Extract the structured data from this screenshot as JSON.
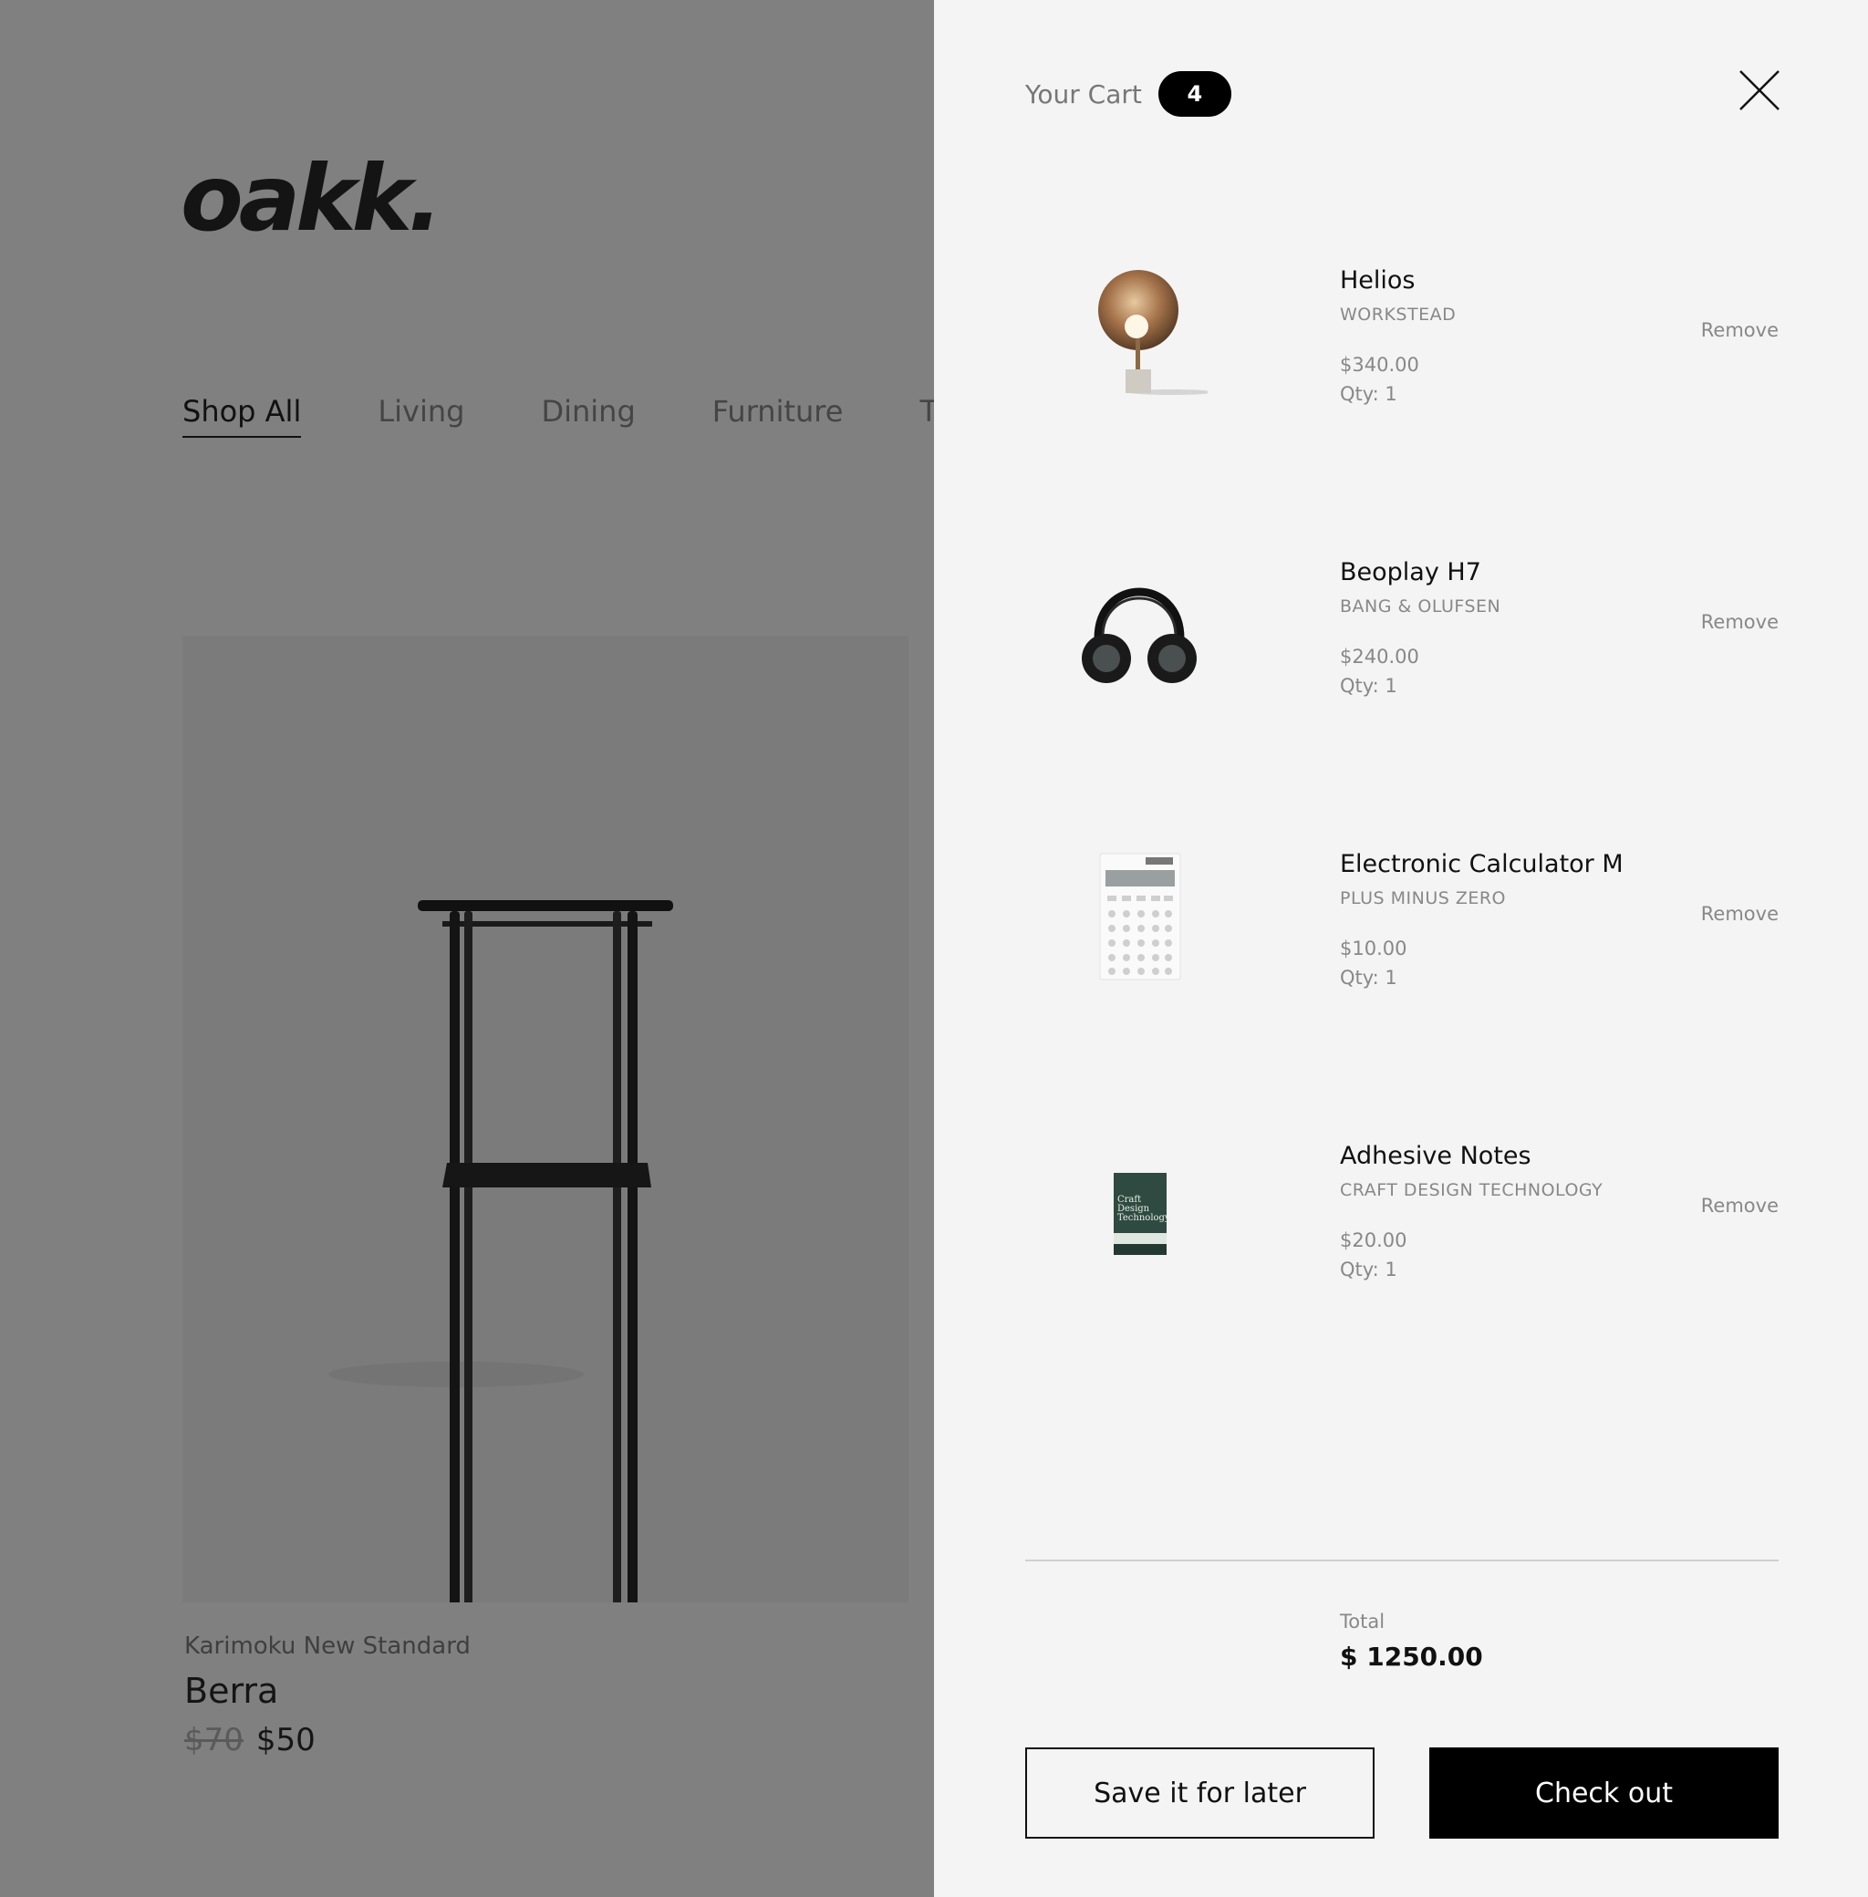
{
  "shop": {
    "logo": "oakk.",
    "nav": [
      "Shop All",
      "Living",
      "Dining",
      "Furniture",
      "Tec"
    ],
    "featured": {
      "brand": "Karimoku New Standard",
      "name": "Berra",
      "old_price": "$70",
      "price": "$50"
    }
  },
  "cart": {
    "title": "Your Cart",
    "count": "4",
    "close_icon": "close-icon",
    "items": [
      {
        "name": "Helios",
        "brand": "WORKSTEAD",
        "price": "$340.00",
        "qty": "Qty: 1",
        "remove": "Remove"
      },
      {
        "name": "Beoplay H7",
        "brand": "BANG & OLUFSEN",
        "price": "$240.00",
        "qty": "Qty: 1",
        "remove": "Remove"
      },
      {
        "name": "Electronic Calculator M",
        "brand": "PLUS MINUS ZERO",
        "price": "$10.00",
        "qty": "Qty: 1",
        "remove": "Remove"
      },
      {
        "name": "Adhesive Notes",
        "brand": "CRAFT DESIGN TECHNOLOGY",
        "price": "$20.00",
        "qty": "Qty: 1",
        "remove": "Remove",
        "notebook_text": [
          "Craft",
          "Design",
          "Technology"
        ]
      }
    ],
    "total_label": "Total",
    "total_value": "$ 1250.00",
    "save_label": "Save it for later",
    "checkout_label": "Check out"
  },
  "colors": {
    "overlay": "#808080",
    "drawer": "#f4f4f4",
    "accent": "#000000",
    "muted_text": "#888888"
  }
}
